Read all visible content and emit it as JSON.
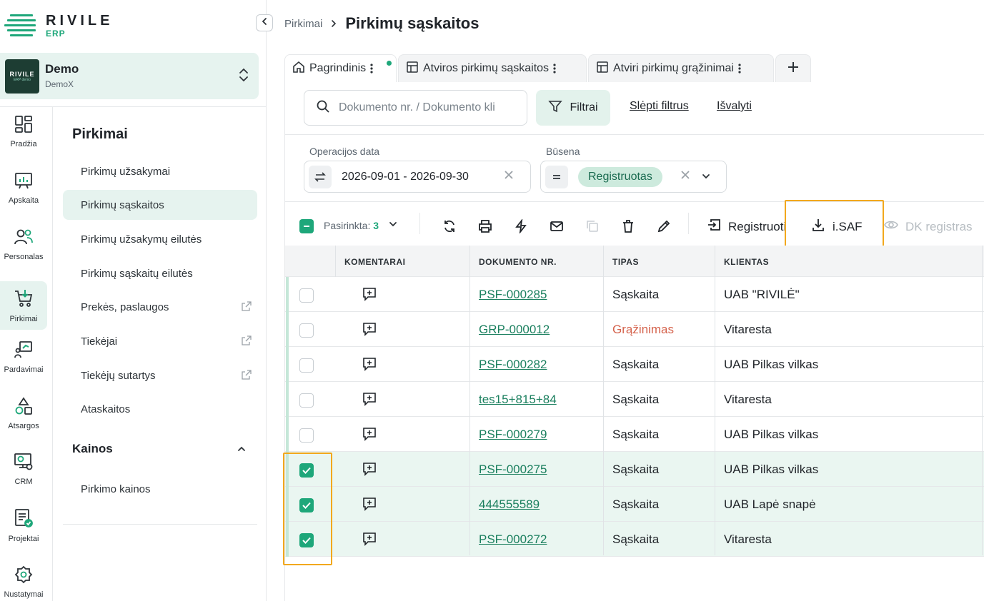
{
  "brand": {
    "name": "RIVILE",
    "sub": "ERP"
  },
  "company": {
    "name": "Demo",
    "sub": "DemoX",
    "logo_text": "RIVILE",
    "logo_small": "ERP demo"
  },
  "rail": [
    {
      "label": "Pradžia",
      "icon": "dashboard-icon"
    },
    {
      "label": "Apskaita",
      "icon": "chart-board-icon"
    },
    {
      "label": "Personalas",
      "icon": "people-icon"
    },
    {
      "label": "Pirkimai",
      "icon": "cart-icon",
      "active": true
    },
    {
      "label": "Pardavimai",
      "icon": "sales-icon"
    },
    {
      "label": "Atsargos",
      "icon": "shapes-icon"
    },
    {
      "label": "CRM",
      "icon": "crm-icon"
    },
    {
      "label": "Projektai",
      "icon": "checklist-icon"
    },
    {
      "label": "Nustatymai",
      "icon": "gear-icon"
    }
  ],
  "subnav": {
    "title": "Pirkimai",
    "items": [
      "Pirkimų užsakymai",
      "Pirkimų sąskaitos",
      "Pirkimų užsakymų eilutės",
      "Pirkimų sąskaitų eilutės",
      "Prekės, paslaugos",
      "Tiekėjai",
      "Tiekėjų sutartys",
      "Ataskaitos"
    ],
    "section": "Kainos",
    "section_items": [
      "Pirkimo kainos"
    ]
  },
  "breadcrumb": {
    "parent": "Pirkimai",
    "current": "Pirkimų sąskaitos"
  },
  "tabs": [
    "Pagrindinis",
    "Atviros pirkimų sąskaitos",
    "Atviri pirkimų grąžinimai"
  ],
  "search": {
    "placeholder": "Dokumento nr. / Dokumento kli"
  },
  "filters": {
    "button": "Filtrai",
    "hide": "Slėpti filtrus",
    "clear": "Išvalyti"
  },
  "filter_fields": {
    "date_label": "Operacijos data",
    "date_value": "2026-09-01 - 2026-09-30",
    "status_label": "Būsena",
    "status_value": "Registruotas"
  },
  "toolbar": {
    "selected_label": "Pasirinkta:",
    "selected_count": "3",
    "register": "Registruoti",
    "isaf": "i.SAF",
    "dk": "DK registras"
  },
  "table": {
    "headers": [
      "KOMENTARAI",
      "DOKUMENTO NR.",
      "TIPAS",
      "KLIENTAS"
    ],
    "rows": [
      {
        "doc": "PSF-000285",
        "type": "Sąskaita",
        "client": "UAB \"RIVILĖ\"",
        "checked": false
      },
      {
        "doc": "GRP-000012",
        "type": "Grąžinimas",
        "client": "Vitaresta",
        "checked": false
      },
      {
        "doc": "PSF-000282",
        "type": "Sąskaita",
        "client": "UAB Pilkas vilkas",
        "checked": false
      },
      {
        "doc": "tes15+815+84",
        "type": "Sąskaita",
        "client": "Vitaresta",
        "checked": false
      },
      {
        "doc": "PSF-000279",
        "type": "Sąskaita",
        "client": "UAB Pilkas vilkas",
        "checked": false
      },
      {
        "doc": "PSF-000275",
        "type": "Sąskaita",
        "client": "UAB Pilkas vilkas",
        "checked": true
      },
      {
        "doc": "444555589",
        "type": "Sąskaita",
        "client": "UAB Lapė snapė",
        "checked": true
      },
      {
        "doc": "PSF-000272",
        "type": "Sąskaita",
        "client": "Vitaresta",
        "checked": true
      }
    ]
  },
  "colors": {
    "accent": "#1ea77a",
    "highlight": "#f2a81d",
    "return": "#d5634d"
  }
}
